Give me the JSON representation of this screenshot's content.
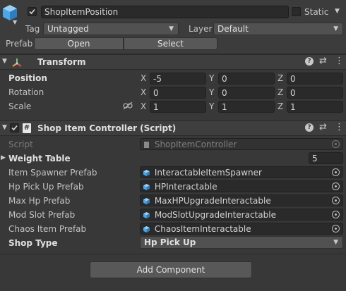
{
  "header": {
    "name_value": "ShopItemPosition",
    "active_checked": true,
    "static_label": "Static",
    "tag_label": "Tag",
    "tag_value": "Untagged",
    "layer_label": "Layer",
    "layer_value": "Default",
    "prefab_label": "Prefab",
    "open_button": "Open",
    "select_button": "Select"
  },
  "transform": {
    "title": "Transform",
    "position_label": "Position",
    "rotation_label": "Rotation",
    "scale_label": "Scale",
    "axis_x": "X",
    "axis_y": "Y",
    "axis_z": "Z",
    "position": {
      "x": "-5",
      "y": "0",
      "z": "0"
    },
    "rotation": {
      "x": "0",
      "y": "0",
      "z": "0"
    },
    "scale": {
      "x": "1",
      "y": "1",
      "z": "1"
    }
  },
  "script_component": {
    "title": "Shop Item Controller (Script)",
    "script_label": "Script",
    "script_value": "ShopItemController",
    "weight_table_label": "Weight Table",
    "weight_table_count": "5",
    "item_spawner_label": "Item Spawner Prefab",
    "item_spawner_value": "InteractableItemSpawner",
    "hp_pickup_label": "Hp Pick Up Prefab",
    "hp_pickup_value": "HPInteractable",
    "max_hp_label": "Max Hp Prefab",
    "max_hp_value": "MaxHPUpgradeInteractable",
    "mod_slot_label": "Mod Slot Prefab",
    "mod_slot_value": "ModSlotUpgradeInteractable",
    "chaos_item_label": "Chaos Item Prefab",
    "chaos_item_value": "ChaosItemInteractable",
    "shop_type_label": "Shop Type",
    "shop_type_value": "Hp Pick Up"
  },
  "footer": {
    "add_component_button": "Add Component"
  },
  "colors": {
    "background": "#383838",
    "field": "#2a2a2a",
    "prefab_cube": "#4aa8e8"
  }
}
